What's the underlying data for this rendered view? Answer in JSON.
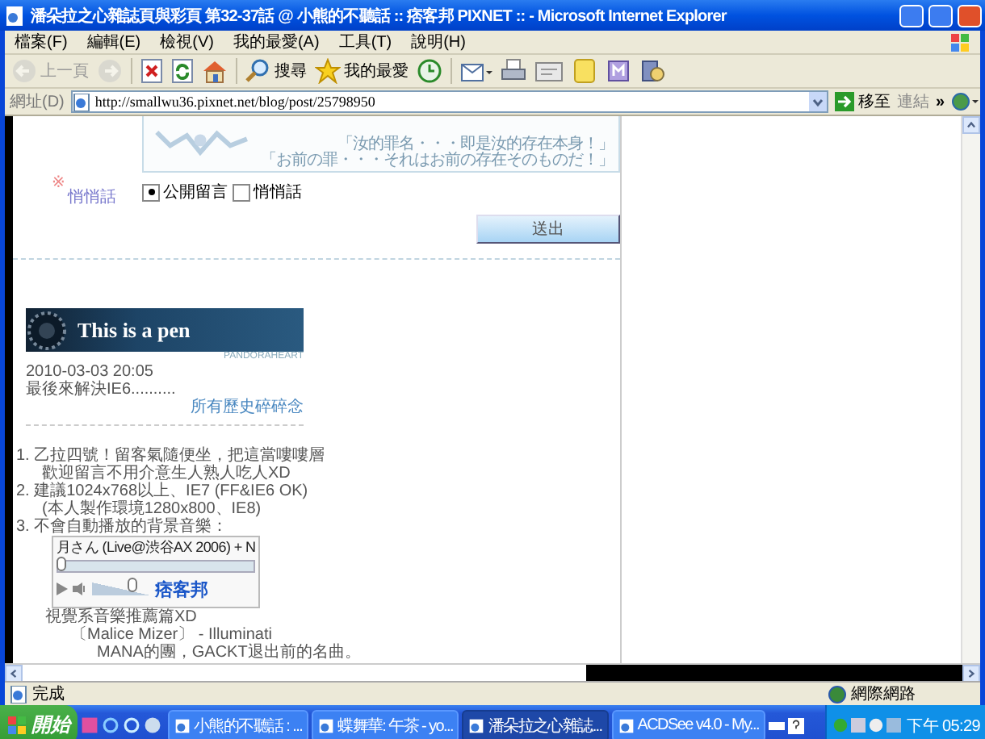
{
  "window": {
    "title": "潘朵拉之心雜誌頁與彩頁 第32-37話 @ 小熊的不聽話 :: 痞客邦 PIXNET :: - Microsoft Internet Explorer"
  },
  "menu": [
    "檔案(F)",
    "編輯(E)",
    "檢視(V)",
    "我的最愛(A)",
    "工具(T)",
    "說明(H)"
  ],
  "toolbar": [
    {
      "kind": "back",
      "label": "上一頁",
      "disabled": true
    },
    {
      "kind": "forward",
      "disabled": true
    },
    {
      "kind": "stop",
      "disabled": false
    },
    {
      "kind": "refresh",
      "disabled": false
    },
    {
      "kind": "home",
      "disabled": false
    },
    {
      "kind": "search",
      "label": "搜尋",
      "disabled": false
    },
    {
      "kind": "favorites",
      "label": "我的最愛",
      "disabled": false
    },
    {
      "kind": "history",
      "disabled": false
    },
    {
      "kind": "mail",
      "disabled": false
    },
    {
      "kind": "print",
      "disabled": false
    },
    {
      "kind": "edit",
      "disabled": false
    },
    {
      "kind": "note",
      "disabled": false
    },
    {
      "kind": "messenger",
      "disabled": false
    },
    {
      "kind": "media",
      "disabled": false
    }
  ],
  "address": {
    "label": "網址(D)",
    "url": "http://smallwu36.pixnet.net/blog/post/25798950",
    "go": "移至",
    "links": "連結",
    "more": "»"
  },
  "page": {
    "quotes": [
      "「汝的罪名・・・即是汝的存在本身！」",
      "「お前の罪・・・それはお前の存在そのものだ！」"
    ],
    "required_mark": "※",
    "privacy_label": "悄悄話",
    "radios": [
      {
        "label": "公開留言",
        "selected": true
      },
      {
        "label": "悄悄話",
        "selected": false
      }
    ],
    "submit": "送出",
    "banner": {
      "title": "This is a pen",
      "subtitle": "PANDORAHEART"
    },
    "date": "2010-03-03 20:05",
    "post": "最後來解決IE6..........",
    "history_link": "所有歷史碎碎念",
    "notes": [
      {
        "lines": [
          "1. 乙拉四號！留客氣隨便坐，把這當嘍嘍層",
          "歡迎留言不用介意生人熟人吃人XD"
        ]
      },
      {
        "lines": [
          "2. 建議1024x768以上、IE7 (FF&IE6 OK)",
          "(本人製作環境1280x800、IE8)"
        ]
      },
      {
        "lines": [
          "3. 不會自動播放的背景音樂："
        ]
      }
    ],
    "player": {
      "track": "月さん (Live@渋谷AX 2006) + N",
      "seek": {
        "level": 0
      },
      "volume": {
        "level": 0.7
      },
      "logo": "痞客邦"
    },
    "recommend": [
      "視覺系音樂推薦篇XD",
      "〔Malice Mizer〕 - Illuminati",
      "MANA的團，GACKT退出前的名曲。"
    ]
  },
  "status_bar": {
    "text": "完成",
    "zone": "網際網路"
  },
  "taskbar": {
    "start": "開始",
    "tasks": [
      {
        "label": "小熊的不聽話 : ...",
        "selected": false
      },
      {
        "label": "蝶舞華: 午茶 - yo...",
        "selected": false
      },
      {
        "label": "潘朵拉之心雜誌...",
        "selected": true
      },
      {
        "label": "ACDSee v4.0 - My...",
        "selected": false
      }
    ],
    "clock": "下午 05:29"
  }
}
